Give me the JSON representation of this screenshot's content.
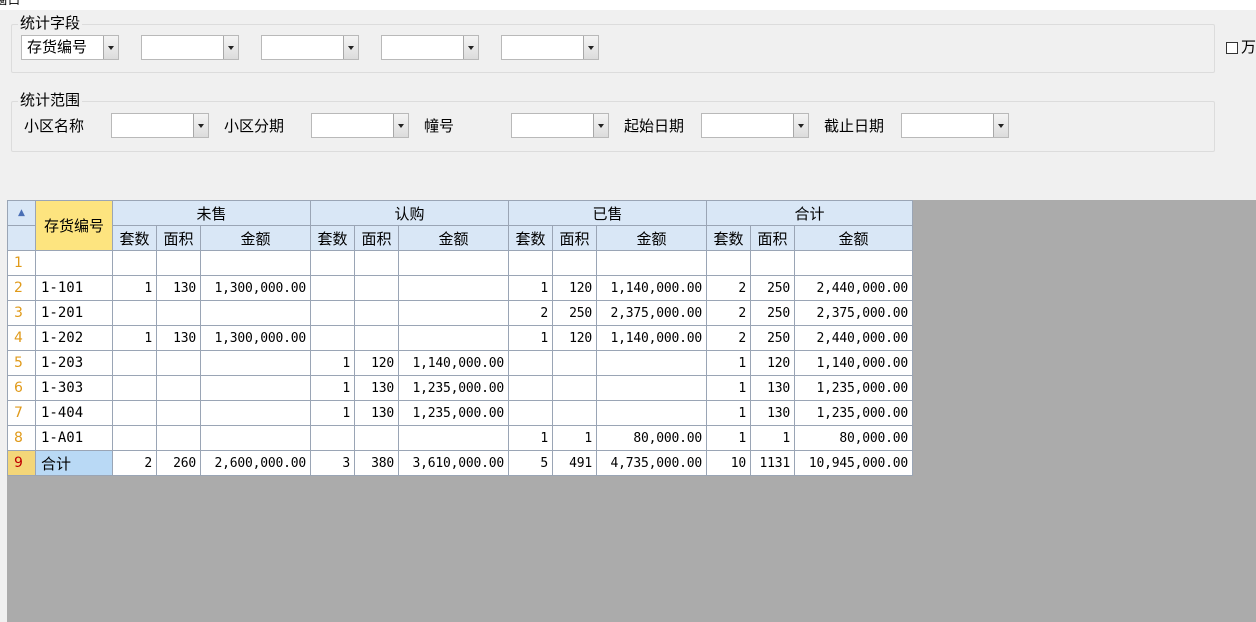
{
  "window": {
    "title": "窗口"
  },
  "stat_fields": {
    "legend": "统计字段",
    "combos": [
      {
        "value": "存货编号"
      },
      {
        "value": ""
      },
      {
        "value": ""
      },
      {
        "value": ""
      },
      {
        "value": ""
      }
    ],
    "checkbox_label": "万"
  },
  "stat_range": {
    "legend": "统计范围",
    "filters": [
      {
        "label": "小区名称",
        "value": ""
      },
      {
        "label": "小区分期",
        "value": ""
      },
      {
        "label": "幢号",
        "value": ""
      },
      {
        "label": "起始日期",
        "value": ""
      },
      {
        "label": "截止日期",
        "value": ""
      }
    ]
  },
  "grid": {
    "key_header": "存货编号",
    "groups": [
      "未售",
      "认购",
      "已售",
      "合计"
    ],
    "sub_headers": [
      "套数",
      "面积",
      "金额"
    ],
    "rows": [
      {
        "num": "1",
        "code": "",
        "cells": [
          "",
          "",
          "",
          "",
          "",
          "",
          "",
          "",
          "",
          "",
          "",
          ""
        ]
      },
      {
        "num": "2",
        "code": "1-101",
        "cells": [
          "1",
          "130",
          "1,300,000.00",
          "",
          "",
          "",
          "1",
          "120",
          "1,140,000.00",
          "2",
          "250",
          "2,440,000.00"
        ]
      },
      {
        "num": "3",
        "code": "1-201",
        "cells": [
          "",
          "",
          "",
          "",
          "",
          "",
          "2",
          "250",
          "2,375,000.00",
          "2",
          "250",
          "2,375,000.00"
        ]
      },
      {
        "num": "4",
        "code": "1-202",
        "cells": [
          "1",
          "130",
          "1,300,000.00",
          "",
          "",
          "",
          "1",
          "120",
          "1,140,000.00",
          "2",
          "250",
          "2,440,000.00"
        ]
      },
      {
        "num": "5",
        "code": "1-203",
        "cells": [
          "",
          "",
          "",
          "1",
          "120",
          "1,140,000.00",
          "",
          "",
          "",
          "1",
          "120",
          "1,140,000.00"
        ]
      },
      {
        "num": "6",
        "code": "1-303",
        "cells": [
          "",
          "",
          "",
          "1",
          "130",
          "1,235,000.00",
          "",
          "",
          "",
          "1",
          "130",
          "1,235,000.00"
        ]
      },
      {
        "num": "7",
        "code": "1-404",
        "cells": [
          "",
          "",
          "",
          "1",
          "130",
          "1,235,000.00",
          "",
          "",
          "",
          "1",
          "130",
          "1,235,000.00"
        ]
      },
      {
        "num": "8",
        "code": "1-A01",
        "cells": [
          "",
          "",
          "",
          "",
          "",
          "",
          "1",
          "1",
          "80,000.00",
          "1",
          "1",
          "80,000.00"
        ]
      },
      {
        "num": "9",
        "code": "合计",
        "cells": [
          "2",
          "260",
          "2,600,000.00",
          "3",
          "380",
          "3,610,000.00",
          "5",
          "491",
          "4,735,000.00",
          "10",
          "1131",
          "10,945,000.00"
        ]
      }
    ],
    "selected_row": 8,
    "colors": {
      "header_bg": "#d9e7f6",
      "key_header_bg": "#fde47f",
      "selected_cell_bg": "#b9d9f5",
      "row_number_color": "#e09a1a",
      "empty_area_bg": "#ababab"
    }
  }
}
